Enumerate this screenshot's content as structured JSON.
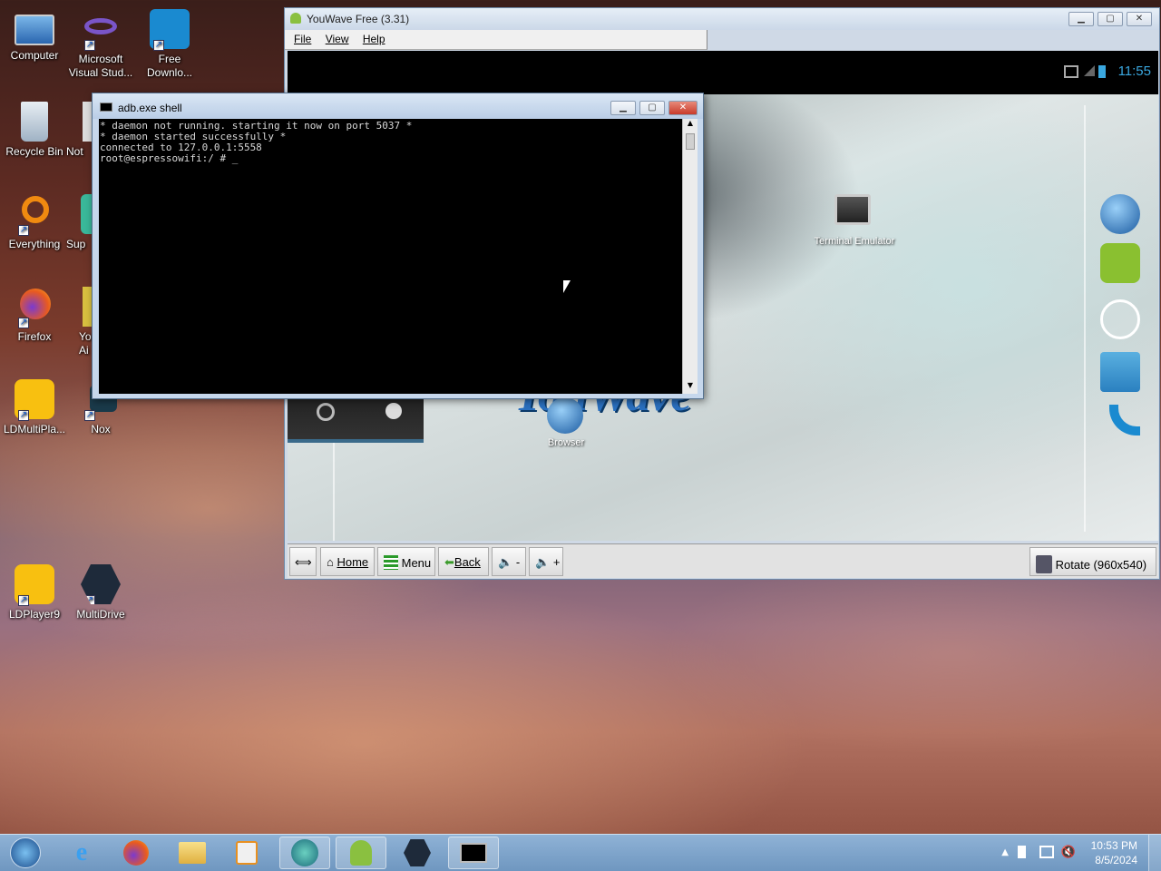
{
  "desktop": {
    "icons": [
      {
        "label": "Computer"
      },
      {
        "label": "Microsoft Visual Stud..."
      },
      {
        "label": "Free Downlo..."
      },
      {
        "label": "Recycle Bin"
      },
      {
        "label": "Not"
      },
      {
        "label": "Everything"
      },
      {
        "label": "Sup"
      },
      {
        "label": "Firefox"
      },
      {
        "label": "Yo Ai"
      },
      {
        "label": "LDMultiPla..."
      },
      {
        "label": "Nox"
      },
      {
        "label": "LDPlayer9"
      },
      {
        "label": "MultiDrive"
      }
    ]
  },
  "youwave": {
    "title": "YouWave Free (3.31)",
    "menu": [
      "File",
      "View",
      "Help"
    ],
    "android": {
      "clock": "11:55",
      "logo_text": "YouWave",
      "apps": [
        {
          "label": "Terminal Emulator"
        },
        {
          "label": "Browser"
        }
      ]
    },
    "toolbar": {
      "home": "Home",
      "menu": "Menu",
      "back": "Back",
      "vol_down": "-",
      "vol_up": "+",
      "rotate": "Rotate (960x540)"
    }
  },
  "adb": {
    "title": "adb.exe  shell",
    "lines": [
      "* daemon not running. starting it now on port 5037 *",
      "* daemon started successfully *",
      "connected to 127.0.0.1:5558",
      "root@espressowifi:/ # _"
    ]
  },
  "taskbar": {
    "time": "10:53 PM",
    "date": "8/5/2024"
  }
}
